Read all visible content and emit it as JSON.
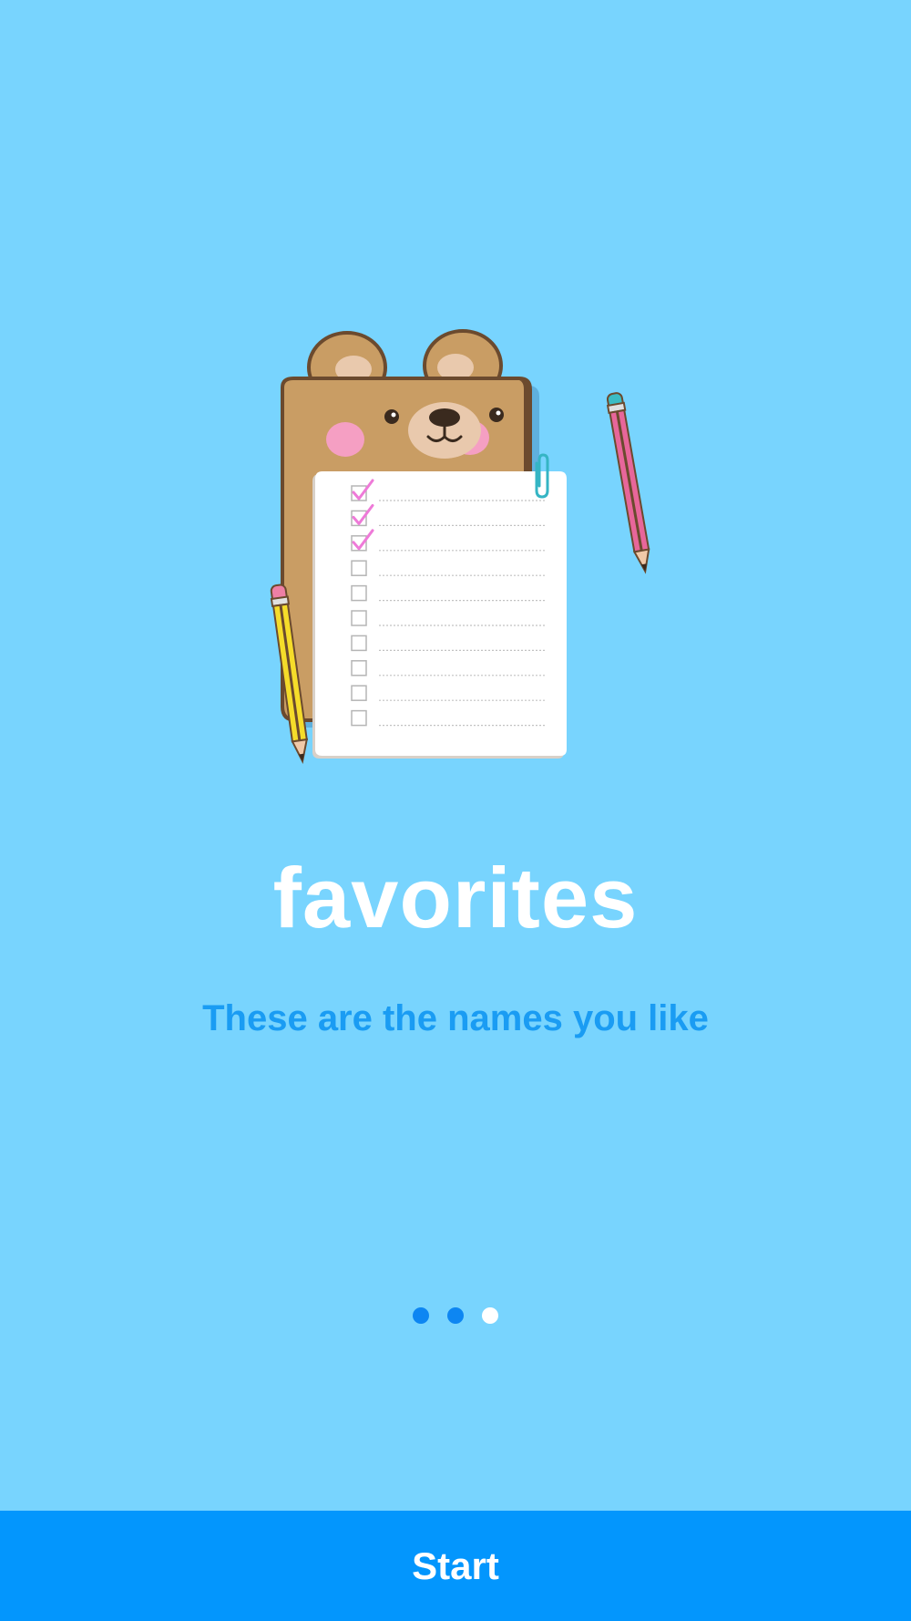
{
  "onboarding": {
    "title": "favorites",
    "subtitle": "These are the names you like",
    "start_label": "Start",
    "checklist": {
      "checked_count": 3,
      "total_rows": 10
    },
    "pagination": {
      "total": 3,
      "active_indices": [
        0,
        1
      ],
      "active_color": "#0d86f2",
      "inactive_color": "#ffffff"
    }
  },
  "colors": {
    "background": "#78d4fe",
    "title": "#ffffff",
    "subtitle": "#1a9cf3",
    "button": "#0396fd",
    "clipboard": "#c99d64",
    "check_mark": "#ee7ad8"
  }
}
